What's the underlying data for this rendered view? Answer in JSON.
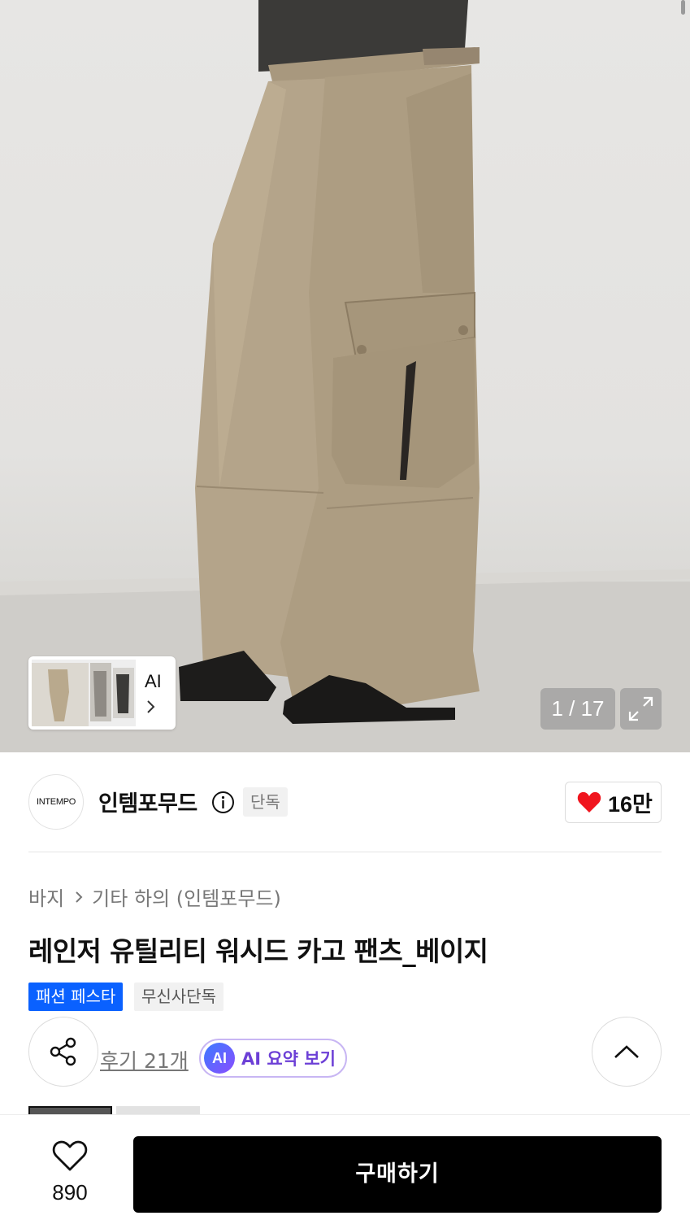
{
  "hero": {
    "image_alt": "beige cargo pants photo",
    "thumbnail_ai_label": "AI",
    "counter": "1 / 17",
    "current_index": 1,
    "total_images": 17
  },
  "brand": {
    "logo_text": "INTEMPO",
    "name": "인템포무드",
    "exclusive_badge": "단독",
    "like_count": "16만"
  },
  "breadcrumb": {
    "items": [
      "바지",
      "기타 하의 (인템포무드)"
    ]
  },
  "product": {
    "title": "레인저 유틸리티 워시드 카고 팬츠_베이지",
    "tags": [
      "패션 페스타",
      "무신사단독"
    ]
  },
  "actions": {
    "review_link": "후기 21개",
    "ai_badge": "AI",
    "ai_summary_label": "AI 요약 보기"
  },
  "bottom_bar": {
    "wish_count": "890",
    "buy_label": "구매하기"
  },
  "colors": {
    "accent_blue": "#0a61ff",
    "heart_red": "#f0151e",
    "ai_purple": "#6c3fd6",
    "buy_button": "#000000"
  },
  "icons": [
    "info-icon",
    "heart-icon",
    "share-icon",
    "chevron-up-icon",
    "expand-icon",
    "chevron-right-icon",
    "heart-outline-icon"
  ]
}
